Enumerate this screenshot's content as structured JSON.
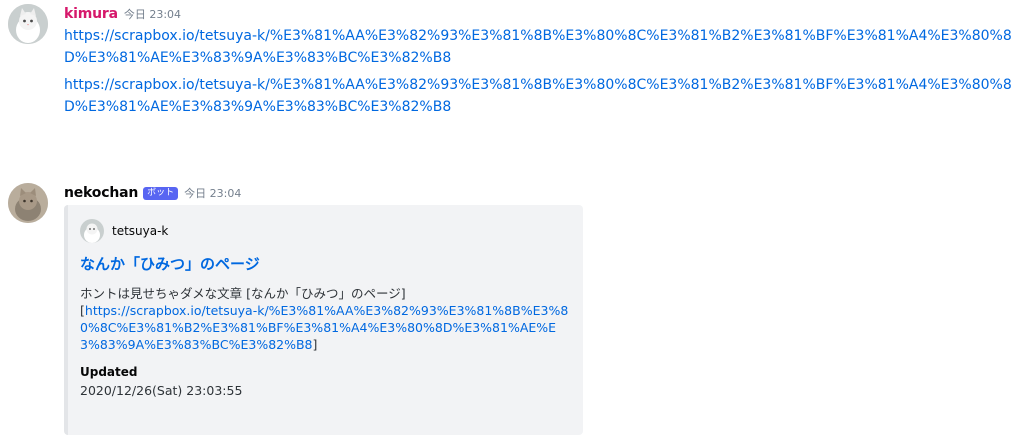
{
  "messages": [
    {
      "username": "kimura",
      "username_color": "#d6186b",
      "timestamp": "今日 23:04",
      "avatar_icon": "cat-avatar-icon",
      "links": [
        "https://scrapbox.io/tetsuya-k/%E3%81%AA%E3%82%93%E3%81%8B%E3%80%8C%E3%81%B2%E3%81%BF%E3%81%A4%E3%80%8D%E3%81%AE%E3%83%9A%E3%83%BC%E3%82%B8",
        "https://scrapbox.io/tetsuya-k/%E3%81%AA%E3%82%93%E3%81%8B%E3%80%8C%E3%81%B2%E3%81%BF%E3%81%A4%E3%80%8D%E3%81%AE%E3%83%9A%E3%83%BC%E3%82%B8"
      ]
    },
    {
      "username": "nekochan",
      "username_color": "#060607",
      "badge": "ボット",
      "timestamp": "今日 23:04",
      "avatar_icon": "cat-avatar-icon",
      "embed": {
        "author": "tetsuya-k",
        "title": "なんか「ひみつ」のページ",
        "description_text": "ホントは見せちゃダメな文章 [なんか「ひみつ」のページ]",
        "description_link": "https://scrapbox.io/tetsuya-k/%E3%81%AA%E3%82%93%E3%81%8B%E3%80%8C%E3%81%B2%E3%81%BF%E3%81%A4%E3%80%8D%E3%81%AE%E3%83%9A%E3%83%BC%E3%82%B8",
        "field_name": "Updated",
        "field_value": "2020/12/26(Sat) 23:03:55"
      }
    }
  ]
}
